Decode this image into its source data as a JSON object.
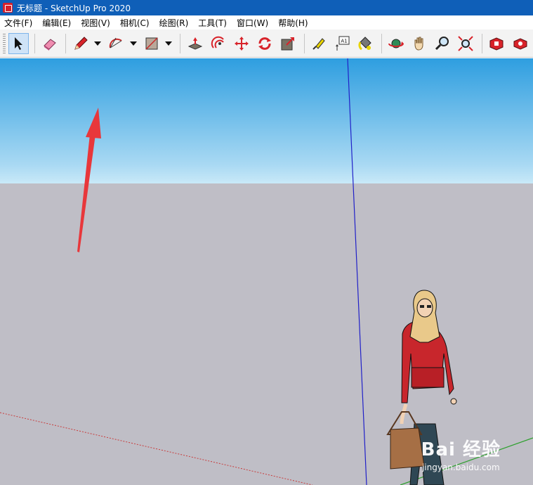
{
  "window": {
    "title": "无标题 - SketchUp Pro 2020"
  },
  "menu": [
    {
      "label": "文件(F)"
    },
    {
      "label": "编辑(E)"
    },
    {
      "label": "视图(V)"
    },
    {
      "label": "相机(C)"
    },
    {
      "label": "绘图(R)"
    },
    {
      "label": "工具(T)"
    },
    {
      "label": "窗口(W)"
    },
    {
      "label": "帮助(H)"
    }
  ],
  "toolbar": {
    "tools": [
      "select-icon",
      "eraser-icon",
      "pencil-icon",
      "arc-icon",
      "rectangle-icon",
      "push-pull-icon",
      "offset-icon",
      "move-icon",
      "rotate-icon",
      "scale-icon",
      "tape-measure-icon",
      "text-icon",
      "paint-bucket-icon",
      "orbit-icon",
      "pan-icon",
      "zoom-icon",
      "zoom-extents-icon",
      "warehouse-icon",
      "extension-icon"
    ],
    "text_tool_label": "A1"
  },
  "viewport": {
    "sky_color": "#2e9ee0",
    "ground_color": "#bfbec6",
    "axes": {
      "blue": "#2020c8",
      "red": "#c83c3c",
      "green": "#2ca02c"
    },
    "annotation_arrow_color": "#e8373b"
  },
  "watermark": {
    "main": "Bai 经验",
    "sub": "jingyan.baidu.com"
  }
}
